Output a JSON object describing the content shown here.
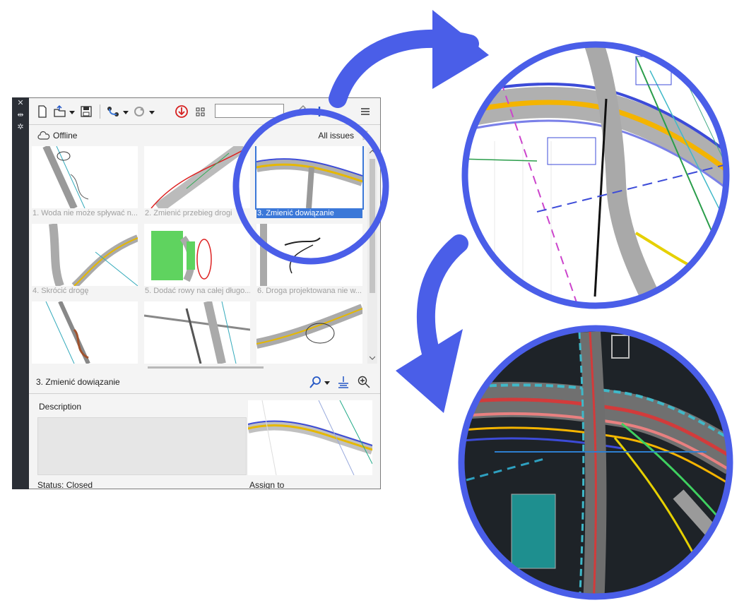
{
  "toolbar": {
    "icons": [
      "new-document-icon",
      "open-folder-icon",
      "dropdown-arrow-icon",
      "save-icon",
      "link-icon",
      "sync-icon",
      "download-alert-icon",
      "grid-view-icon",
      "pencil-icon",
      "plus-icon",
      "hamburger-menu-icon"
    ],
    "search_value": ""
  },
  "status": {
    "connection": "Offline",
    "filter": "All issues"
  },
  "issues": [
    {
      "caption": "1. Woda nie może spływać n...",
      "selected": false
    },
    {
      "caption": "2. Zmienić przebieg drogi",
      "selected": false
    },
    {
      "caption": "3. Zmienić dowiązanie",
      "selected": true
    },
    {
      "caption": "4. Skrócić drogę",
      "selected": false
    },
    {
      "caption": "5. Dodać rowy na całej długo...",
      "selected": false
    },
    {
      "caption": "6. Droga projektowana nie w...",
      "selected": false
    },
    {
      "caption": "",
      "selected": false
    },
    {
      "caption": "",
      "selected": false
    },
    {
      "caption": "",
      "selected": false
    }
  ],
  "detail": {
    "title": "3. Zmienić dowiązanie",
    "description_label": "Description",
    "description_value": "",
    "status_text": "Status: Closed",
    "assign_label": "Assign to"
  },
  "colors": {
    "accent": "#3b78d8",
    "ring": "#4a5ee8",
    "cad_dark": "#1e2328",
    "alert": "#d62020"
  }
}
